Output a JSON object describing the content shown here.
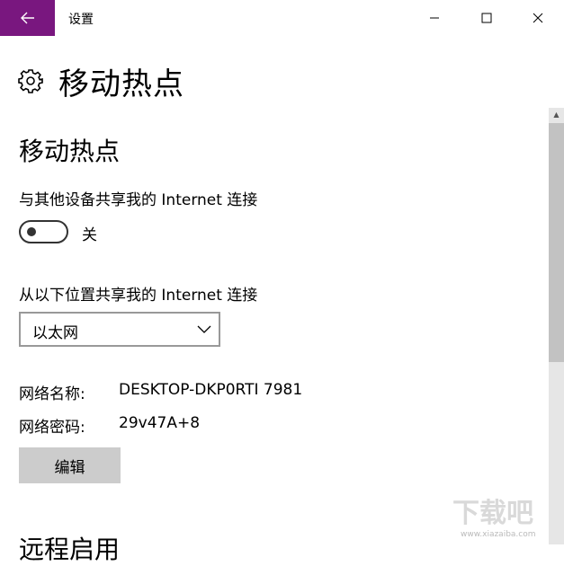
{
  "window": {
    "title": "设置",
    "back_icon": "arrow-left-icon",
    "accent_color": "#79177f",
    "controls": [
      "minimize-icon",
      "maximize-icon",
      "close-icon"
    ]
  },
  "header": {
    "icon": "gear-icon",
    "title": "移动热点"
  },
  "hotspot": {
    "section_title": "移动热点",
    "share_label": "与其他设备共享我的 Internet 连接",
    "toggle_state": "关",
    "toggle_on": false,
    "source_label": "从以下位置共享我的 Internet 连接",
    "source_selected": "以太网",
    "network_name_label": "网络名称:",
    "network_name_value": "DESKTOP-DKP0RTI 7981",
    "network_password_label": "网络密码:",
    "network_password_value": "29v47A+8",
    "edit_button": "编辑"
  },
  "next_section": {
    "title": "远程启用"
  },
  "watermark": {
    "text": "下载吧",
    "url": "www.xiazaiba.com"
  }
}
